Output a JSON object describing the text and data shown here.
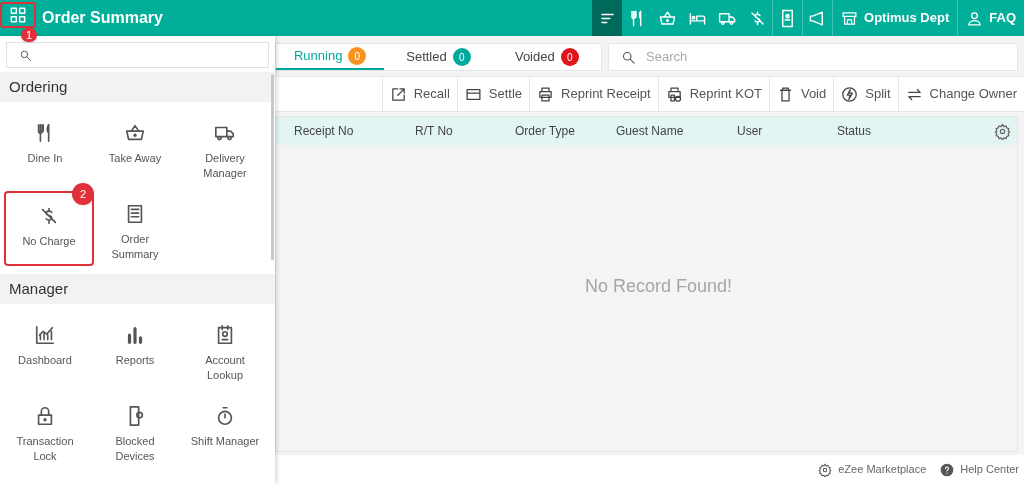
{
  "header": {
    "title": "Order Summary",
    "menu_callout": "1",
    "icons": [
      {
        "kind": "list",
        "selected": true
      },
      {
        "kind": "dine",
        "selected": false
      },
      {
        "kind": "basket",
        "selected": false
      },
      {
        "kind": "bed",
        "selected": false
      },
      {
        "kind": "truck",
        "selected": false
      },
      {
        "kind": "nocharge",
        "selected": false
      },
      {
        "kind": "tablet",
        "selected": false
      },
      {
        "kind": "megaphone",
        "selected": false
      }
    ],
    "links": [
      {
        "kind": "store",
        "label": "Optimus Dept"
      },
      {
        "kind": "user",
        "label": "FAQ"
      }
    ]
  },
  "menu": {
    "sections": [
      {
        "title": "Ordering",
        "items": [
          {
            "kind": "dine",
            "label": "Dine In"
          },
          {
            "kind": "basket",
            "label": "Take Away"
          },
          {
            "kind": "truck",
            "label": "Delivery Manager"
          },
          {
            "kind": "nocharge",
            "label": "No Charge",
            "callout": "2"
          },
          {
            "kind": "receipt",
            "label": "Order Summary"
          }
        ]
      },
      {
        "title": "Manager",
        "items": [
          {
            "kind": "chart",
            "label": "Dashboard"
          },
          {
            "kind": "bars",
            "label": "Reports"
          },
          {
            "kind": "badge",
            "label": "Account Lookup"
          },
          {
            "kind": "lock",
            "label": "Transaction Lock"
          },
          {
            "kind": "phone",
            "label": "Blocked Devices"
          },
          {
            "kind": "timer",
            "label": "Shift Manager"
          }
        ]
      }
    ]
  },
  "tabs": [
    {
      "label": "Running",
      "count": "0",
      "color": "#f7931e",
      "selected": true
    },
    {
      "label": "Settled",
      "count": "0",
      "color": "#00a99d",
      "selected": false
    },
    {
      "label": "Voided",
      "count": "0",
      "color": "#e0151b",
      "selected": false
    }
  ],
  "search": {
    "placeholder": "Search"
  },
  "toolbar": [
    {
      "kind": "recall",
      "label": "Recall"
    },
    {
      "kind": "card",
      "label": "Settle"
    },
    {
      "kind": "print",
      "label": "Reprint Receipt"
    },
    {
      "kind": "kot",
      "label": "Reprint KOT"
    },
    {
      "kind": "trash",
      "label": "Void"
    },
    {
      "kind": "bolt",
      "label": "Split"
    },
    {
      "kind": "swap",
      "label": "Change Owner"
    }
  ],
  "table": {
    "columns": [
      "Receipt No",
      "R/T No",
      "Order Type",
      "Guest Name",
      "User",
      "Status"
    ],
    "empty_message": "No Record Found!"
  },
  "footer": [
    {
      "kind": "gear",
      "label": "eZee Marketplace"
    },
    {
      "kind": "help",
      "label": "Help Center"
    }
  ]
}
